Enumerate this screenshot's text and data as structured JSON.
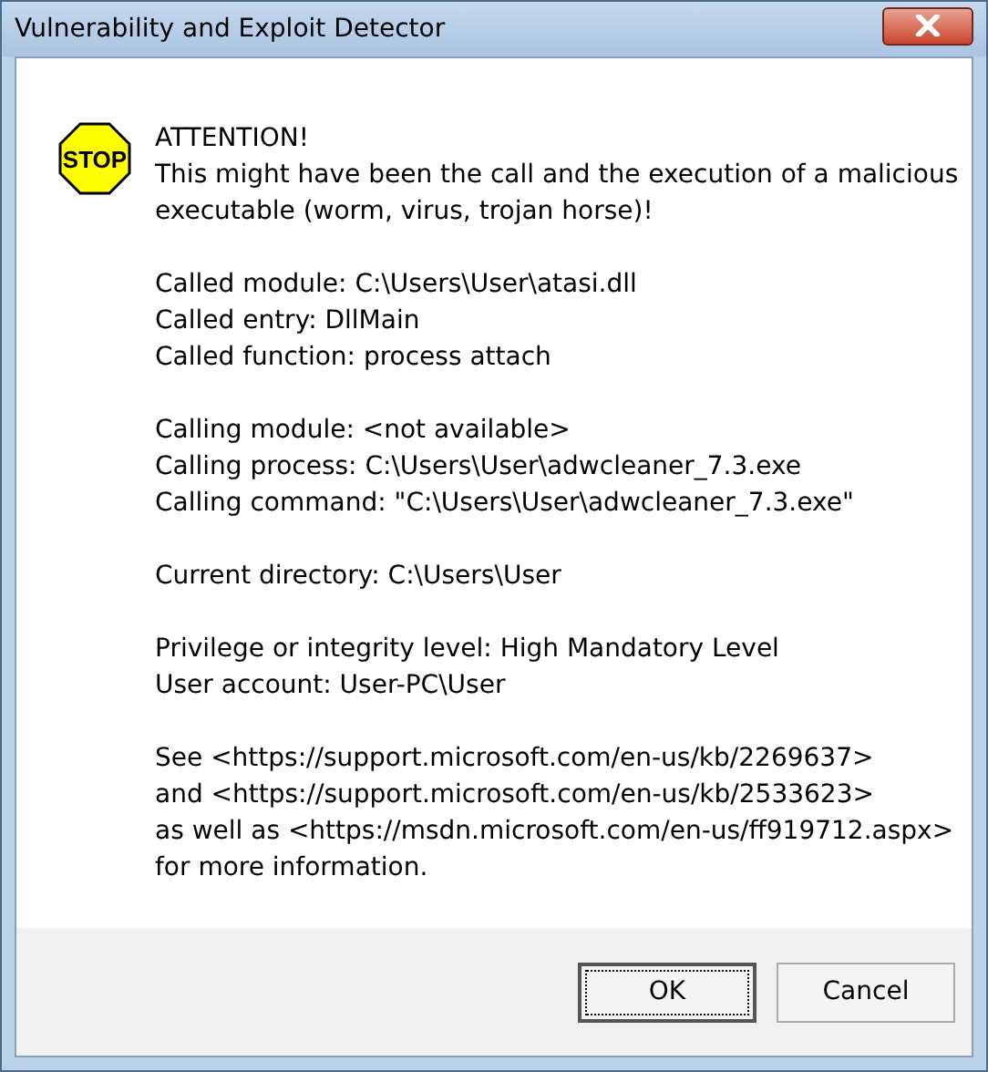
{
  "window": {
    "title": "Vulnerability and Exploit Detector"
  },
  "stop_icon": {
    "label": "STOP"
  },
  "message": [
    [
      "ATTENTION!",
      "This might have been the call and the execution of a malicious",
      "executable (worm, virus, trojan horse)!"
    ],
    [
      "Called module: C:\\Users\\User\\atasi.dll",
      "Called entry: DllMain",
      "Called function: process attach"
    ],
    [
      "Calling module: <not available>",
      "Calling process: C:\\Users\\User\\adwcleaner_7.3.exe",
      "Calling command: \"C:\\Users\\User\\adwcleaner_7.3.exe\""
    ],
    [
      "Current directory: C:\\Users\\User"
    ],
    [
      "Privilege or integrity level: High Mandatory Level",
      "User account: User-PC\\User"
    ],
    [
      "See <https://support.microsoft.com/en-us/kb/2269637>",
      "and <https://support.microsoft.com/en-us/kb/2533623>",
      "as well as <https://msdn.microsoft.com/en-us/ff919712.aspx>",
      "for more information."
    ]
  ],
  "buttons": [
    {
      "label": "OK",
      "focused": true
    },
    {
      "label": "Cancel",
      "focused": false
    }
  ]
}
